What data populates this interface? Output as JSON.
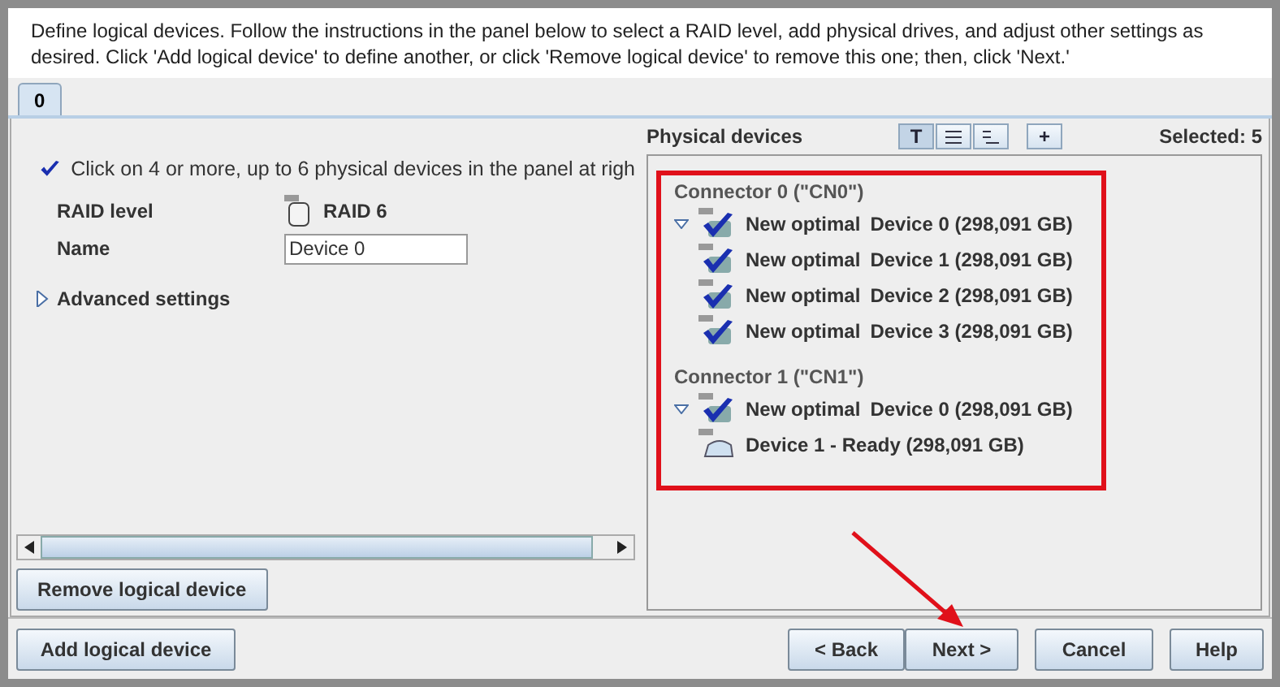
{
  "instructions": "Define logical devices.  Follow the instructions in the panel below to select a RAID level, add physical drives, and adjust other settings as desired.  Click 'Add logical device' to define another, or click 'Remove logical device' to remove this one; then, click 'Next.'",
  "tabs": [
    {
      "label": "0",
      "selected": true
    }
  ],
  "left": {
    "hint": "Click on 4 or more, up to 6 physical devices in the panel at righ",
    "raid_label": "RAID level",
    "raid_value": "RAID 6",
    "name_label": "Name",
    "name_value": "Device 0",
    "advanced": {
      "label": "Advanced settings",
      "expanded": false
    },
    "remove_button": "Remove logical device"
  },
  "physical": {
    "title": "Physical devices",
    "view_buttons": [
      {
        "kind": "text",
        "label": "T",
        "selected": true
      },
      {
        "kind": "lines",
        "selected": false
      },
      {
        "kind": "tree",
        "selected": false
      },
      {
        "kind": "add",
        "label": "+",
        "selected": false
      }
    ],
    "selected_count": "Selected: 5",
    "connectors": [
      {
        "label": "Connector 0 (\"CN0\")",
        "devices": [
          {
            "kind": "selected",
            "expanded": true,
            "status": "New optimal",
            "label": "Device 0 (298,091 GB)"
          },
          {
            "kind": "selected",
            "expanded": false,
            "status": "New optimal",
            "label": "Device 1 (298,091 GB)"
          },
          {
            "kind": "selected",
            "expanded": false,
            "status": "New optimal",
            "label": "Device 2 (298,091 GB)"
          },
          {
            "kind": "selected",
            "expanded": false,
            "status": "New optimal",
            "label": "Device 3 (298,091 GB)"
          }
        ]
      },
      {
        "label": "Connector 1 (\"CN1\")",
        "devices": [
          {
            "kind": "selected",
            "expanded": true,
            "status": "New optimal",
            "label": "Device 0 (298,091 GB)"
          },
          {
            "kind": "ready",
            "expanded": false,
            "label": "Device 1 - Ready (298,091 GB)"
          }
        ]
      }
    ]
  },
  "buttons": {
    "add": "Add logical device",
    "back": "< Back",
    "next": "Next >",
    "cancel": "Cancel",
    "help": "Help"
  }
}
